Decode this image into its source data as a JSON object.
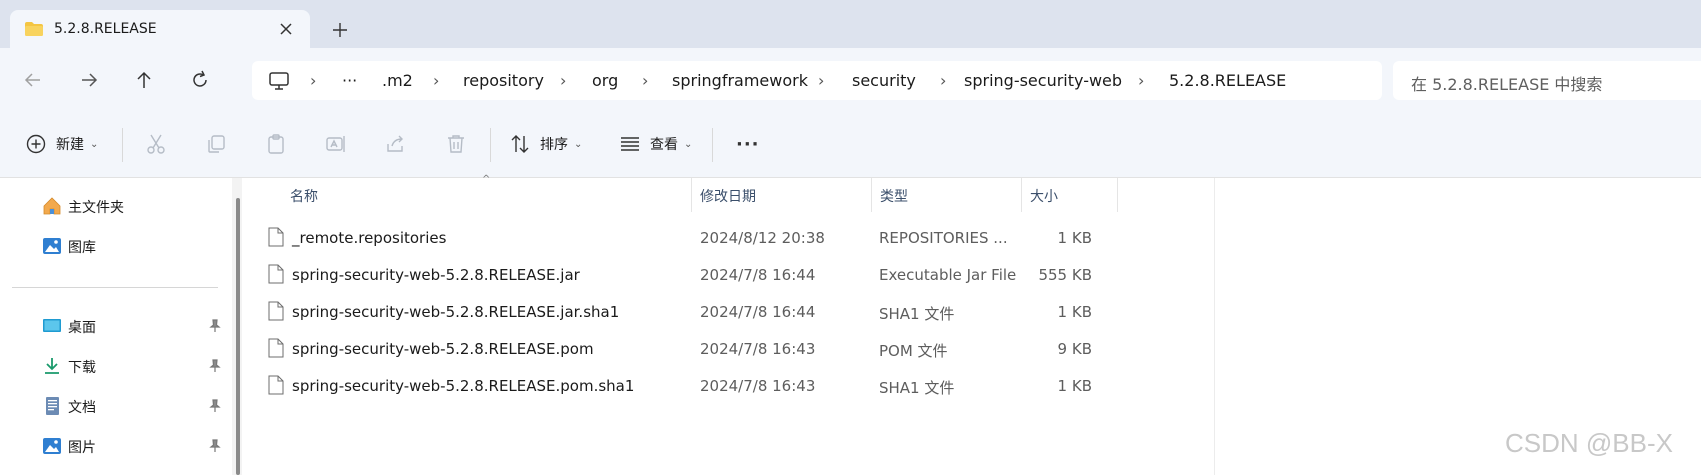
{
  "tab": {
    "title": "5.2.8.RELEASE"
  },
  "breadcrumbs": [
    ".m2",
    "repository",
    "org",
    "springframework",
    "security",
    "spring-security-web",
    "5.2.8.RELEASE"
  ],
  "overflow_label": "···",
  "search": {
    "placeholder": "在 5.2.8.RELEASE 中搜索"
  },
  "toolbar": {
    "new_label": "新建",
    "sort_label": "排序",
    "view_label": "查看",
    "more_label": "···"
  },
  "sidebar": {
    "items": [
      {
        "label": "主文件夹",
        "icon": "home-icon",
        "pinned": false
      },
      {
        "label": "图库",
        "icon": "gallery-icon",
        "pinned": false
      },
      {
        "label": "桌面",
        "icon": "desktop-icon",
        "pinned": true
      },
      {
        "label": "下载",
        "icon": "download-icon",
        "pinned": true
      },
      {
        "label": "文档",
        "icon": "document-icon",
        "pinned": true
      },
      {
        "label": "图片",
        "icon": "pictures-icon",
        "pinned": true
      }
    ]
  },
  "columns": {
    "name": "名称",
    "date": "修改日期",
    "type": "类型",
    "size": "大小"
  },
  "files": [
    {
      "name": "_remote.repositories",
      "date": "2024/8/12 20:38",
      "type": "REPOSITORIES ...",
      "size": "1 KB"
    },
    {
      "name": "spring-security-web-5.2.8.RELEASE.jar",
      "date": "2024/7/8 16:44",
      "type": "Executable Jar File",
      "size": "555 KB"
    },
    {
      "name": "spring-security-web-5.2.8.RELEASE.jar.sha1",
      "date": "2024/7/8 16:44",
      "type": "SHA1 文件",
      "size": "1 KB"
    },
    {
      "name": "spring-security-web-5.2.8.RELEASE.pom",
      "date": "2024/7/8 16:43",
      "type": "POM 文件",
      "size": "9 KB"
    },
    {
      "name": "spring-security-web-5.2.8.RELEASE.pom.sha1",
      "date": "2024/7/8 16:43",
      "type": "SHA1 文件",
      "size": "1 KB"
    }
  ],
  "watermark": "CSDN @BB-X",
  "colors": {
    "chrome": "#f3f6fb",
    "titlebar": "#dde3ee",
    "folder": "#f4c542",
    "accent": "#0067c0"
  }
}
